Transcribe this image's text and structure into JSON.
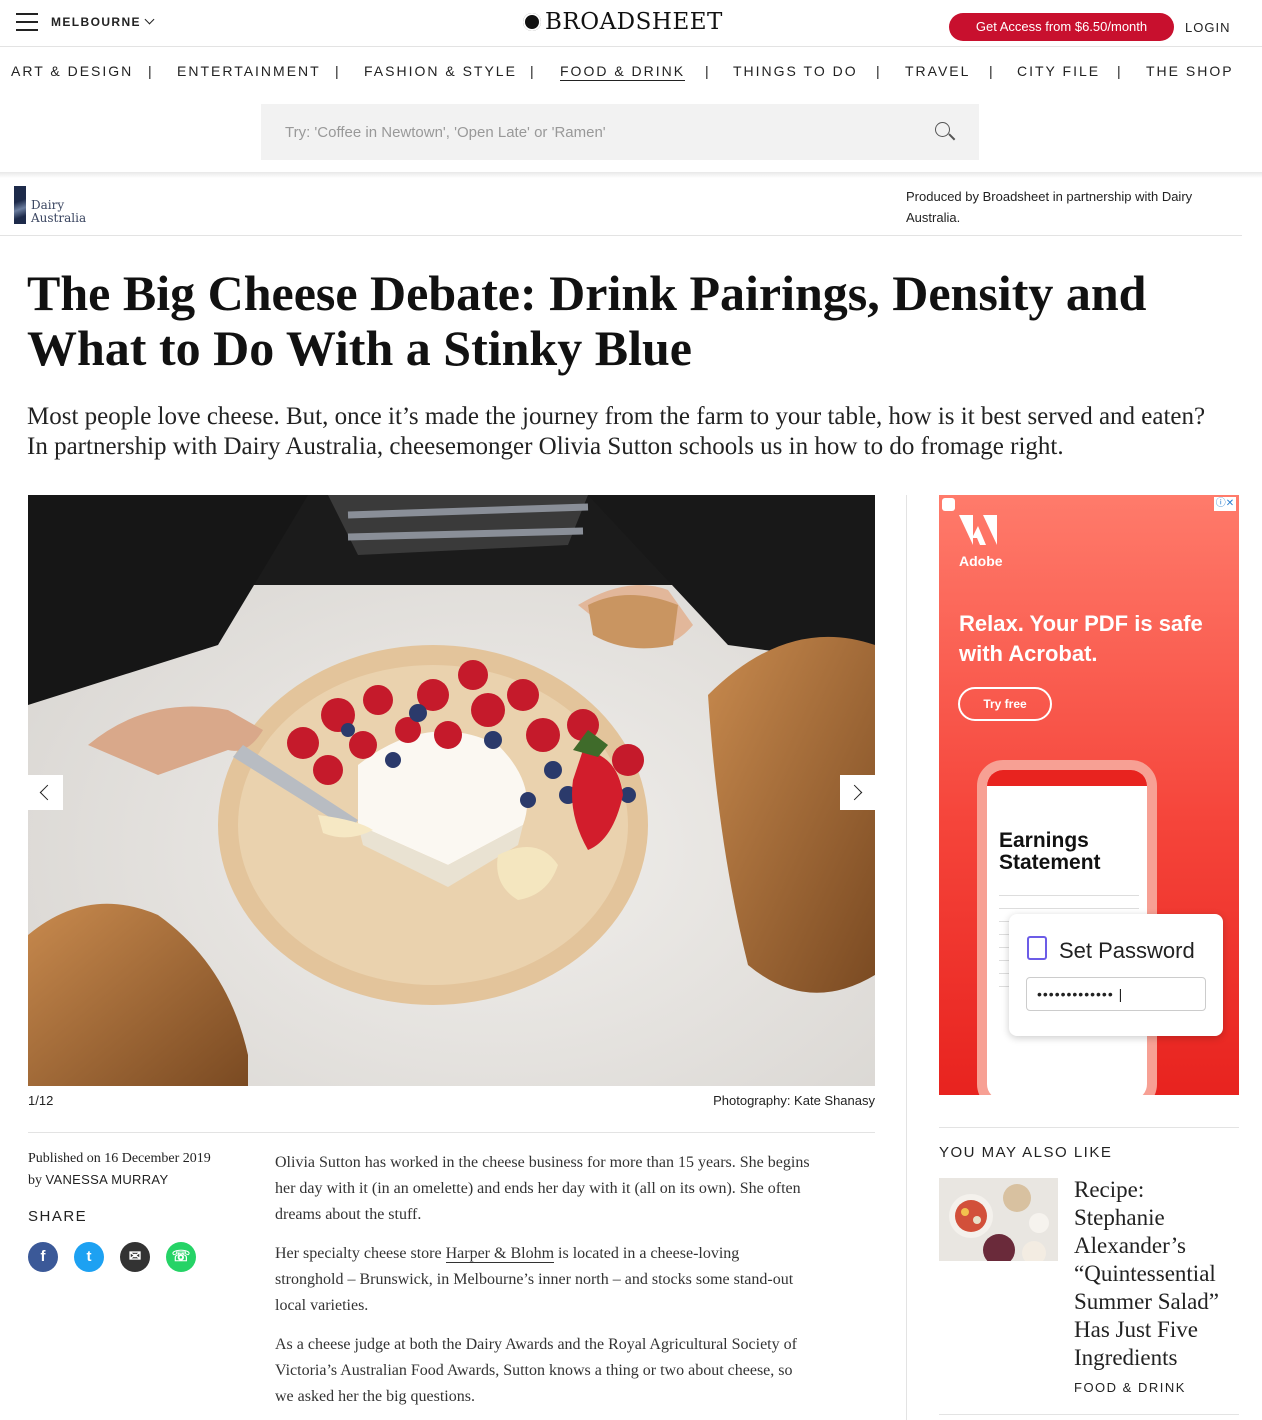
{
  "header": {
    "city": "MELBOURNE",
    "logo": "BROADSHEET",
    "access_button": "Get Access from $6.50/month",
    "login": "LOGIN",
    "accent_color": "#c8102e"
  },
  "nav": {
    "items": [
      {
        "label": "ART & DESIGN"
      },
      {
        "label": "ENTERTAINMENT"
      },
      {
        "label": "FASHION & STYLE"
      },
      {
        "label": "FOOD & DRINK",
        "active": true
      },
      {
        "label": "THINGS TO DO"
      },
      {
        "label": "TRAVEL"
      },
      {
        "label": "CITY FILE"
      },
      {
        "label": "THE SHOP"
      }
    ],
    "separator": "|"
  },
  "search": {
    "placeholder": "Try: 'Coffee in Newtown', 'Open Late' or 'Ramen'",
    "icon": "search-icon"
  },
  "partner": {
    "logo_text_line1": "Dairy",
    "logo_text_line2": "Australia",
    "text": "Produced by Broadsheet in partnership with Dairy Australia."
  },
  "article": {
    "title": "The Big Cheese Debate: Drink Pairings, Density and What to Do With a Stinky Blue",
    "intro": "Most people love cheese. But, once it’s made the journey from the farm to your table, how is it best served and eaten? In partnership with Dairy Australia, cheesemonger Olivia Sutton schools us in how to do fromage right.",
    "gallery": {
      "counter": "1/12",
      "credit": "Photography: Kate Shanasy"
    },
    "published": "Published on 16 December 2019",
    "by": "by",
    "author": "VANESSA MURRAY",
    "share_label": "SHARE",
    "share": {
      "facebook": "f",
      "twitter": "t",
      "email": "✉",
      "whatsapp": "☏"
    },
    "body": {
      "p1": "Olivia Sutton has worked in the cheese business for more than 15 years. She begins her day with it (in an omelette) and ends her day with it (all on its own). She often dreams about the stuff.",
      "p2_before": "Her specialty cheese store ",
      "p2_link": "Harper & Blohm",
      "p2_after": " is located in a cheese-loving stronghold – Brunswick, in Melbourne’s inner north – and stocks some stand-out local varieties.",
      "p3": "As a cheese judge at both the Dairy Awards and the Royal Agricultural Society of Victoria’s Australian Food Awards, Sutton knows a thing or two about cheese, so we asked her the big questions."
    }
  },
  "ad": {
    "adchoice": "ⓘ✕",
    "brand": "Adobe",
    "headline": "Relax. Your PDF is safe with Acrobat.",
    "cta": "Try free",
    "phone_title": "Earnings Statement",
    "card_title": "Set Password",
    "card_field": "••••••••••••• |"
  },
  "sidebar": {
    "also_like_label": "YOU MAY ALSO LIKE",
    "item_title": "Recipe: Stephanie Alexander’s “Quintessential Summer Salad” Has Just Five Ingredients",
    "item_category": "FOOD & DRINK"
  }
}
